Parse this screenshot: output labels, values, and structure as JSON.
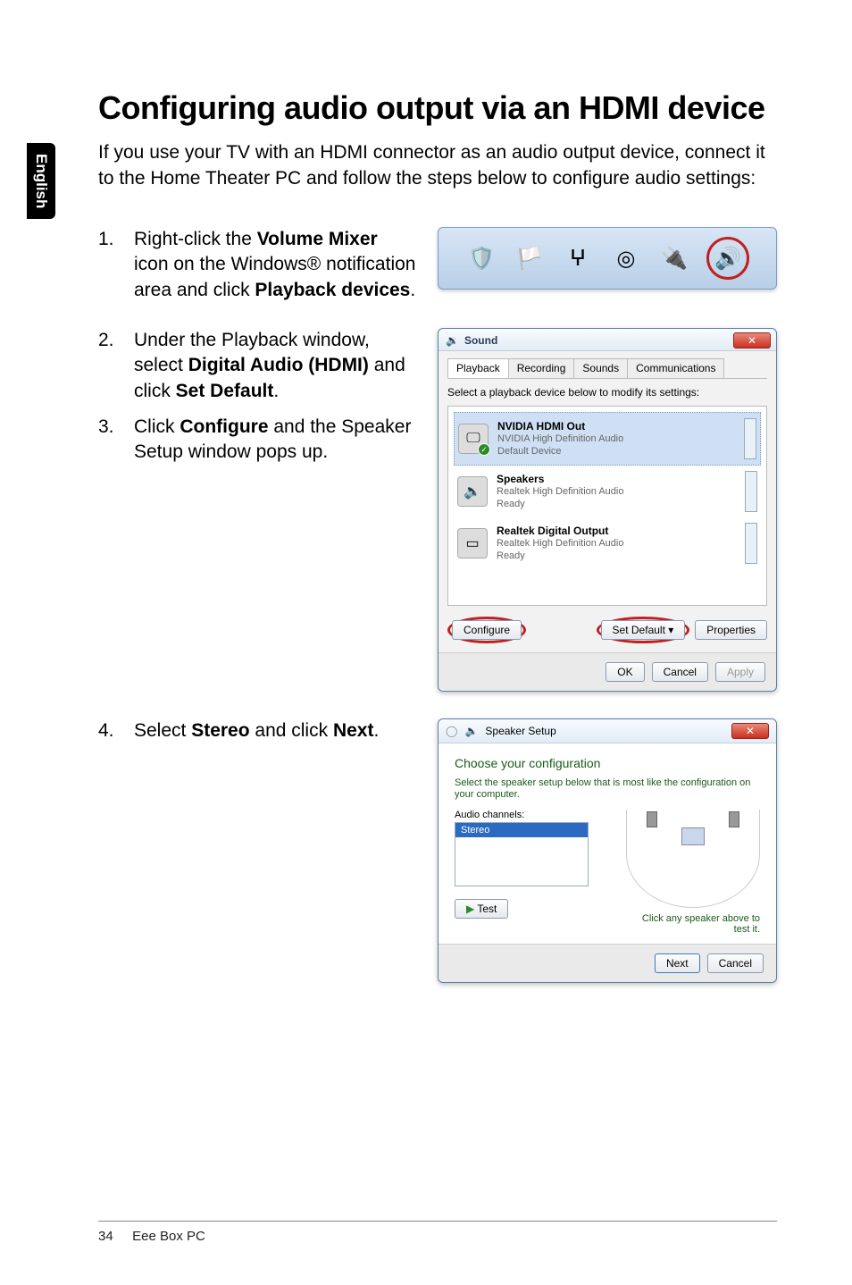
{
  "sidebar": {
    "label": "English"
  },
  "heading": "Configuring audio output via an HDMI device",
  "intro": "If you use your TV with an HDMI connector as an audio output device, connect it to the Home Theater PC and follow the steps below to configure audio settings:",
  "steps": {
    "s1": {
      "num": "1.",
      "pre": "Right-click the ",
      "b1": "Volume Mixer",
      "mid": " icon on the Windows® notification area and click ",
      "b2": "Playback devices",
      "post": "."
    },
    "s2": {
      "num": "2.",
      "pre": "Under the Playback window, select ",
      "b1": "Digital Audio (HDMI)",
      "mid": " and click ",
      "b2": "Set Default",
      "post": "."
    },
    "s3": {
      "num": "3.",
      "pre": "Click ",
      "b1": "Configure",
      "post": " and the Speaker Setup window pops up."
    },
    "s4": {
      "num": "4.",
      "pre": "Select ",
      "b1": "Stereo",
      "mid": " and click ",
      "b2": "Next",
      "post": "."
    }
  },
  "sound_dialog": {
    "title": "Sound",
    "tabs": [
      "Playback",
      "Recording",
      "Sounds",
      "Communications"
    ],
    "instruction": "Select a playback device below to modify its settings:",
    "devices": [
      {
        "name": "NVIDIA HDMI Out",
        "sub1": "NVIDIA High Definition Audio",
        "sub2": "Default Device",
        "checked": true
      },
      {
        "name": "Speakers",
        "sub1": "Realtek High Definition Audio",
        "sub2": "Ready",
        "checked": false
      },
      {
        "name": "Realtek Digital Output",
        "sub1": "Realtek High Definition Audio",
        "sub2": "Ready",
        "checked": false
      }
    ],
    "buttons": {
      "configure": "Configure",
      "set_default": "Set Default",
      "properties": "Properties",
      "ok": "OK",
      "cancel": "Cancel",
      "apply": "Apply"
    }
  },
  "speaker_dialog": {
    "title": "Speaker Setup",
    "heading": "Choose your configuration",
    "sub": "Select the speaker setup below that is most like the configuration on your computer.",
    "channels_label": "Audio channels:",
    "channel_option": "Stereo",
    "test": "Test",
    "hint": "Click any speaker above to test it.",
    "next": "Next",
    "cancel": "Cancel"
  },
  "footer": {
    "page": "34",
    "product": "Eee Box PC"
  }
}
